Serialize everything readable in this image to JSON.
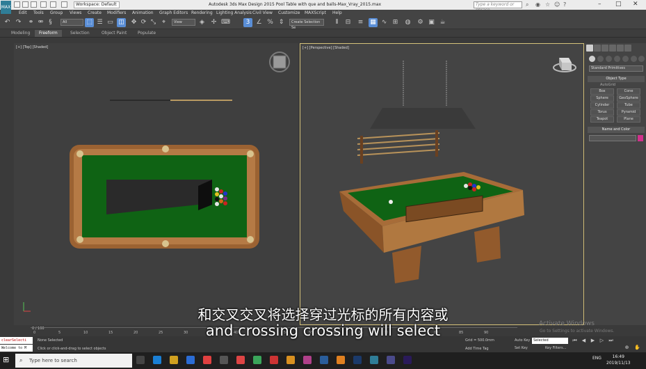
{
  "titlebar": {
    "workspace": "Workspace: Default",
    "title": "Autodesk 3ds Max Design 2015     Pool Table with que and balls-Max_Vray_2015.max",
    "search_placeholder": "Type a keyword or phrase",
    "logo_text": "MAX"
  },
  "menu": [
    "Edit",
    "Tools",
    "Group",
    "Views",
    "Create",
    "Modifiers",
    "Animation",
    "Graph Editors",
    "Rendering",
    "Lighting Analysis",
    "Civil View",
    "Customize",
    "MAXScript",
    "Help"
  ],
  "toolbar": {
    "selection_filter": "All",
    "ref_coord": "View",
    "named_selection": "Create Selection Se"
  },
  "ribbon": {
    "tabs": [
      "Modeling",
      "Freeform",
      "Selection",
      "Object Paint",
      "Populate"
    ],
    "active": "Freeform"
  },
  "viewports": {
    "top_label": "[+] [Top] [Shaded]",
    "persp_label": "[+] [Perspective] [Shaded]"
  },
  "command_panel": {
    "dropdown": "Standard Primitives",
    "object_type_header": "Object Type",
    "autogrid": "AutoGrid",
    "buttons": [
      "Box",
      "Cone",
      "Sphere",
      "GeoSphere",
      "Cylinder",
      "Tube",
      "Torus",
      "Pyramid",
      "Teapot",
      "Plane"
    ],
    "name_color_header": "Name and Color",
    "object_color": "#d1318c"
  },
  "timeline": {
    "frame": "0 / 100",
    "ticks": [
      "0",
      "5",
      "10",
      "15",
      "20",
      "25",
      "30",
      "35",
      "40",
      "45",
      "50",
      "55",
      "60",
      "65",
      "70",
      "75",
      "80",
      "85",
      "90"
    ]
  },
  "status": {
    "maxscript_line1": "clearSelecti",
    "maxscript_line2": "Welcome to M",
    "message1": "None Selected",
    "message2": "Click or click-and-drag to select objects",
    "grid": "Grid = 500.0mm",
    "add_time_tag": "Add Time Tag",
    "auto_key": "Auto Key",
    "set_key": "Set Key",
    "selected": "Selected",
    "key_filters": "Key Filters..."
  },
  "watermark": {
    "line1": "Activate Windows",
    "line2": "Go to Settings to activate Windows."
  },
  "subtitles": {
    "chinese": "和交叉交叉将选择穿过光标的所有内容或",
    "english": "and crossing crossing will select"
  },
  "taskbar": {
    "search_placeholder": "Type here to search",
    "lang": "ENG",
    "time": "16:49",
    "date": "2019/11/13"
  }
}
